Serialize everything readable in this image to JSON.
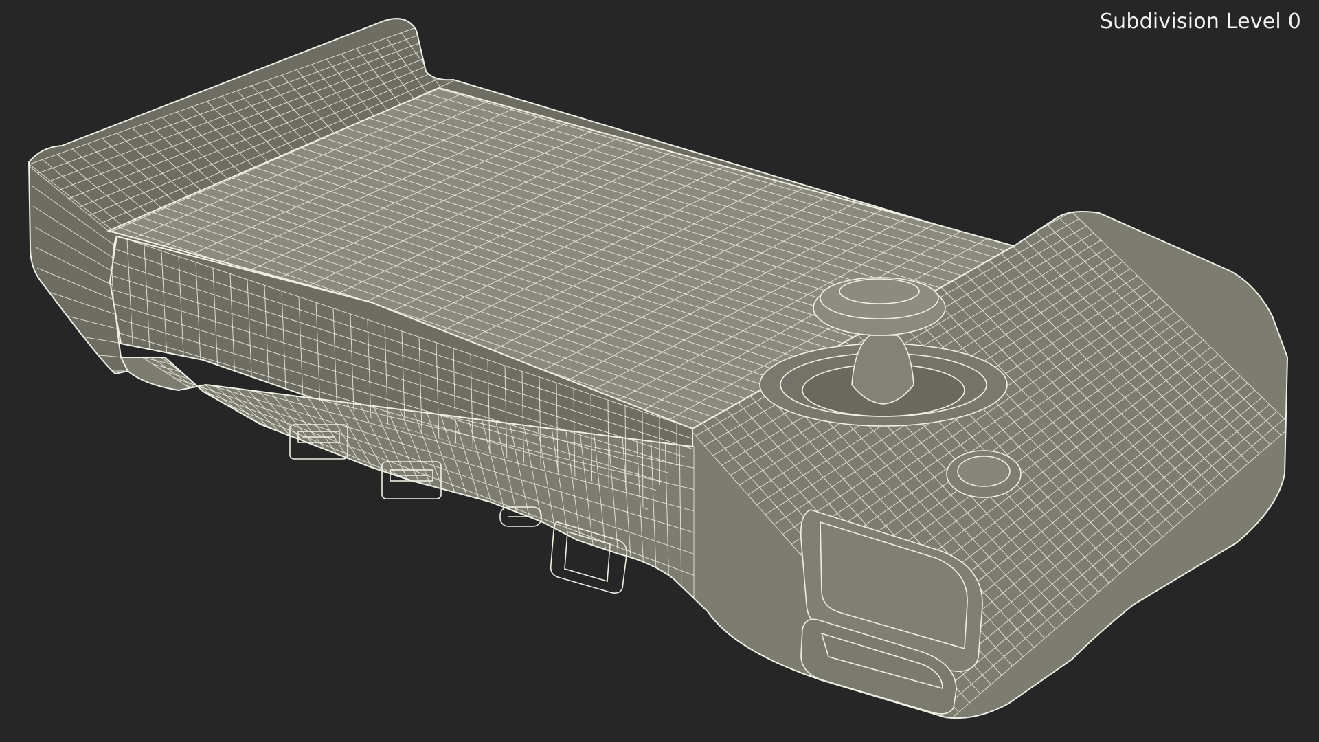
{
  "viewport": {
    "background": "#262626",
    "label": "Subdivision Level 0"
  },
  "model": {
    "fill": "#7d7c70",
    "fill_light": "#8b8a7e",
    "fill_dark": "#6e6d63",
    "wire": "#efeee4",
    "icon": "handheld-console-wireframe"
  }
}
